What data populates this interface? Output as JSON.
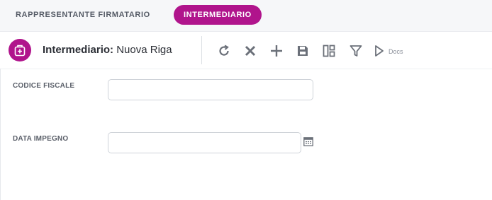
{
  "tabs": [
    {
      "label": "RAPPRESENTANTE FIRMATARIO",
      "active": false
    },
    {
      "label": "INTERMEDIARIO",
      "active": true
    }
  ],
  "header": {
    "entity_label": "Intermediario:",
    "entity_value": "Nuova Riga",
    "logo_icon": "briefcase-plus-icon"
  },
  "toolbar": {
    "icons": [
      "refresh-icon",
      "close-icon",
      "add-icon",
      "save-icon",
      "layout-icon",
      "filter-icon",
      "docs-icon"
    ],
    "docs_label": "Docs"
  },
  "form": {
    "codice_fiscale": {
      "label": "CODICE FISCALE",
      "value": ""
    },
    "data_impegno": {
      "label": "DATA IMPEGNO",
      "value": ""
    }
  },
  "colors": {
    "accent": "#b0148c",
    "icon": "#6b7079"
  }
}
